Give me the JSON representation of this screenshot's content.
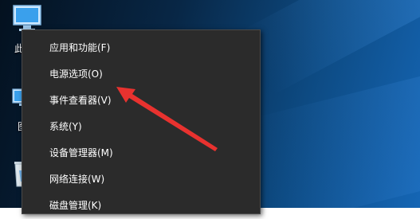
{
  "desktop": {
    "icons": [
      {
        "name": "this-pc",
        "label": "此"
      },
      {
        "name": "network",
        "label": "图"
      },
      {
        "name": "recycle-bin",
        "label": ""
      }
    ]
  },
  "context_menu": {
    "items": [
      {
        "label": "应用和功能(F)"
      },
      {
        "label": "电源选项(O)"
      },
      {
        "label": "事件查看器(V)"
      },
      {
        "label": "系统(Y)"
      },
      {
        "label": "设备管理器(M)"
      },
      {
        "label": "网络连接(W)"
      },
      {
        "label": "磁盘管理(K)"
      }
    ]
  },
  "annotation": {
    "arrow_color": "#e8322f",
    "points_to": "电源选项(O)"
  },
  "colors": {
    "menu_bg": "#2b2b2b",
    "menu_text": "#ffffff"
  }
}
